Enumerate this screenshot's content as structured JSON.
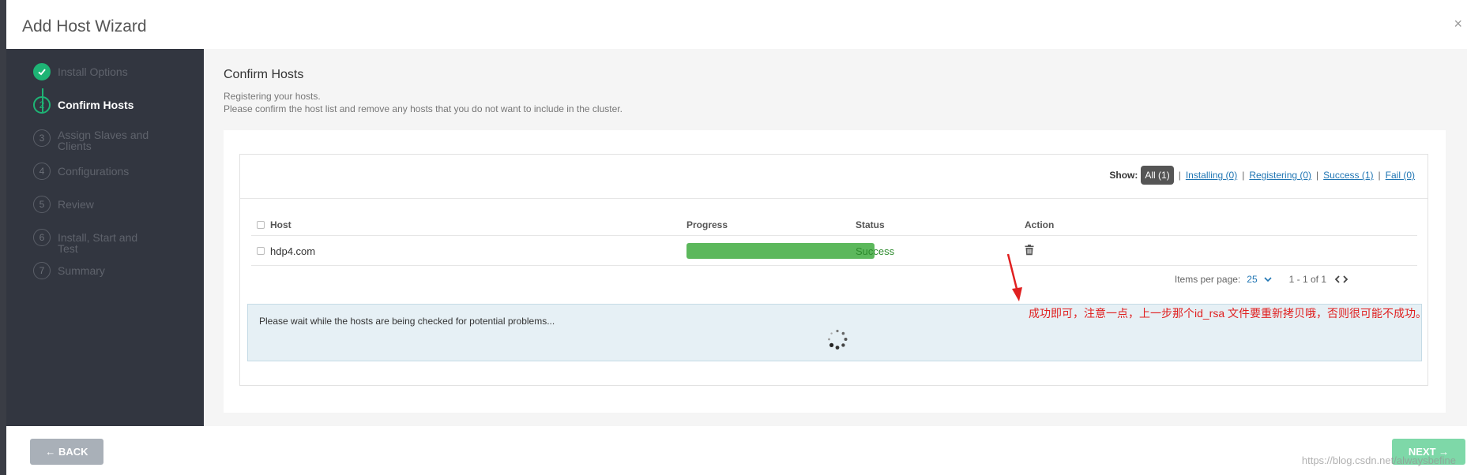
{
  "modal": {
    "title": "Add Host Wizard",
    "close_symbol": "×"
  },
  "steps": [
    {
      "num": "1",
      "label": "Install Options",
      "state": "done"
    },
    {
      "num": "2",
      "label": "Confirm Hosts",
      "state": "active"
    },
    {
      "num": "3",
      "label": "Assign Slaves and Clients",
      "state": "pending"
    },
    {
      "num": "4",
      "label": "Configurations",
      "state": "pending"
    },
    {
      "num": "5",
      "label": "Review",
      "state": "pending"
    },
    {
      "num": "6",
      "label": "Install, Start and Test",
      "state": "pending"
    },
    {
      "num": "7",
      "label": "Summary",
      "state": "pending"
    }
  ],
  "page": {
    "title": "Confirm Hosts",
    "subtitle1": "Registering your hosts.",
    "subtitle2": "Please confirm the host list and remove any hosts that you do not want to include in the cluster."
  },
  "filter": {
    "show_label": "Show:",
    "all": "All (1)",
    "installing": "Installing (0)",
    "registering": "Registering (0)",
    "success": "Success (1)",
    "fail": "Fail (0)"
  },
  "table": {
    "headers": {
      "host": "Host",
      "progress": "Progress",
      "status": "Status",
      "action": "Action"
    },
    "rows": [
      {
        "host": "hdp4.com",
        "progress": 100,
        "status": "Success"
      }
    ]
  },
  "pagination": {
    "label": "Items per page:",
    "per_page": "25",
    "range": "1 - 1 of 1"
  },
  "alert": {
    "message": "Please wait while the hosts are being checked for potential problems..."
  },
  "annotation": {
    "text": "成功即可，注意一点，上一步那个id_rsa 文件要重新拷贝哦，否则很可能不成功。"
  },
  "footer": {
    "back": "← BACK",
    "next": "NEXT →"
  },
  "watermark": "https://blog.csdn.net/alwaysbefine",
  "colors": {
    "accent": "#1eb475",
    "sidebar": "#323640",
    "progress": "#5cb85c",
    "link": "#1f75b3",
    "annotation": "#e02020"
  },
  "icons": {
    "step_done": "check-icon",
    "delete": "trash-icon",
    "loading": "spinner-icon"
  }
}
